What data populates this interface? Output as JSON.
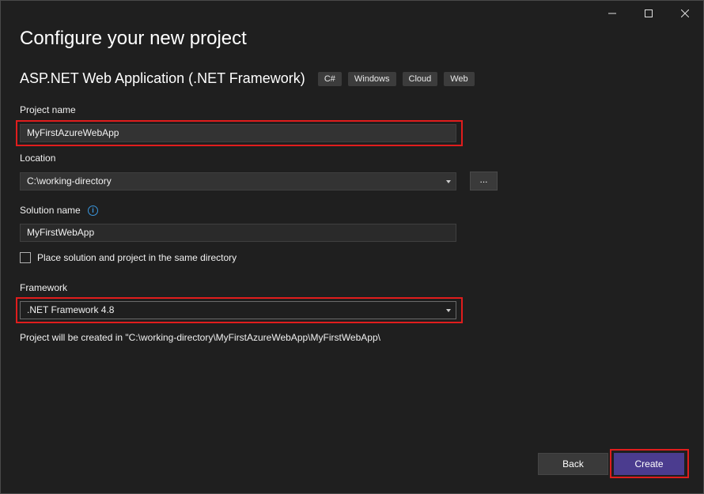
{
  "window": {
    "title": "Configure your new project",
    "controls": [
      "minimize-icon",
      "maximize-icon",
      "close-icon"
    ]
  },
  "template": {
    "name": "ASP.NET Web Application (.NET Framework)",
    "tags": [
      "C#",
      "Windows",
      "Cloud",
      "Web"
    ]
  },
  "project_name": {
    "label": "Project name",
    "value": "MyFirstAzureWebApp"
  },
  "location": {
    "label": "Location",
    "value": "C:\\working-directory",
    "browse_label": "..."
  },
  "solution_name": {
    "label": "Solution name",
    "value": "MyFirstWebApp",
    "info_icon": "i"
  },
  "same_directory": {
    "label": "Place solution and project in the same directory",
    "checked": false
  },
  "framework": {
    "label": "Framework",
    "value": ".NET Framework 4.8"
  },
  "path_note": "Project will be created in \"C:\\working-directory\\MyFirstAzureWebApp\\MyFirstWebApp\\",
  "buttons": {
    "back": "Back",
    "create": "Create"
  },
  "colors": {
    "background": "#1f1f1f",
    "accent": "#4b3c8f",
    "highlight": "#e01d1d",
    "info": "#3a96dd"
  }
}
